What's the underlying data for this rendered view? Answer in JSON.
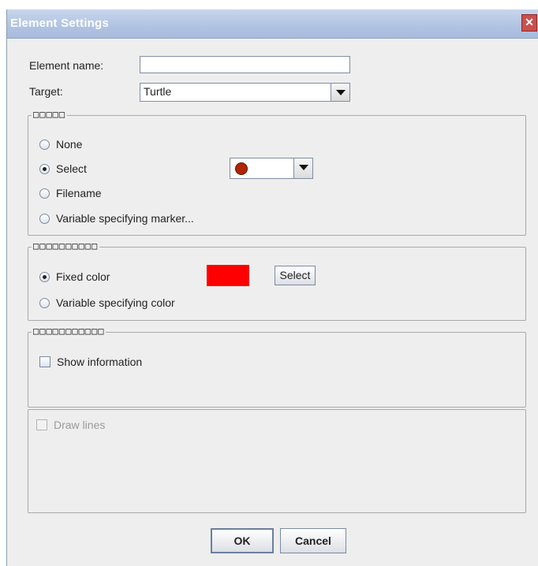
{
  "dialog": {
    "title": "Element Settings",
    "close_glyph": "✕"
  },
  "form": {
    "name_label": "Element name:",
    "name_value": "",
    "target_label": "Target:",
    "target_value": "Turtle"
  },
  "marker_group": {
    "legend": "□□□□□",
    "options": [
      "None",
      "Select",
      "Filename",
      "Variable specifying marker..."
    ],
    "selected": "Select",
    "marker_icon": "red-ball-icon",
    "marker_color": "#b02400"
  },
  "color_group": {
    "legend": "□□□□□□□□□□",
    "options": [
      "Fixed color",
      "Variable specifying color"
    ],
    "selected": "Fixed color",
    "color": "#ff0000",
    "select_button": "Select"
  },
  "info_group": {
    "legend": "□□□□□□□□□□□",
    "show_information_label": "Show information",
    "show_information_checked": false
  },
  "lines_group": {
    "draw_lines_label": "Draw lines",
    "draw_lines_checked": false,
    "enabled": false
  },
  "buttons": {
    "ok": "OK",
    "cancel": "Cancel"
  }
}
